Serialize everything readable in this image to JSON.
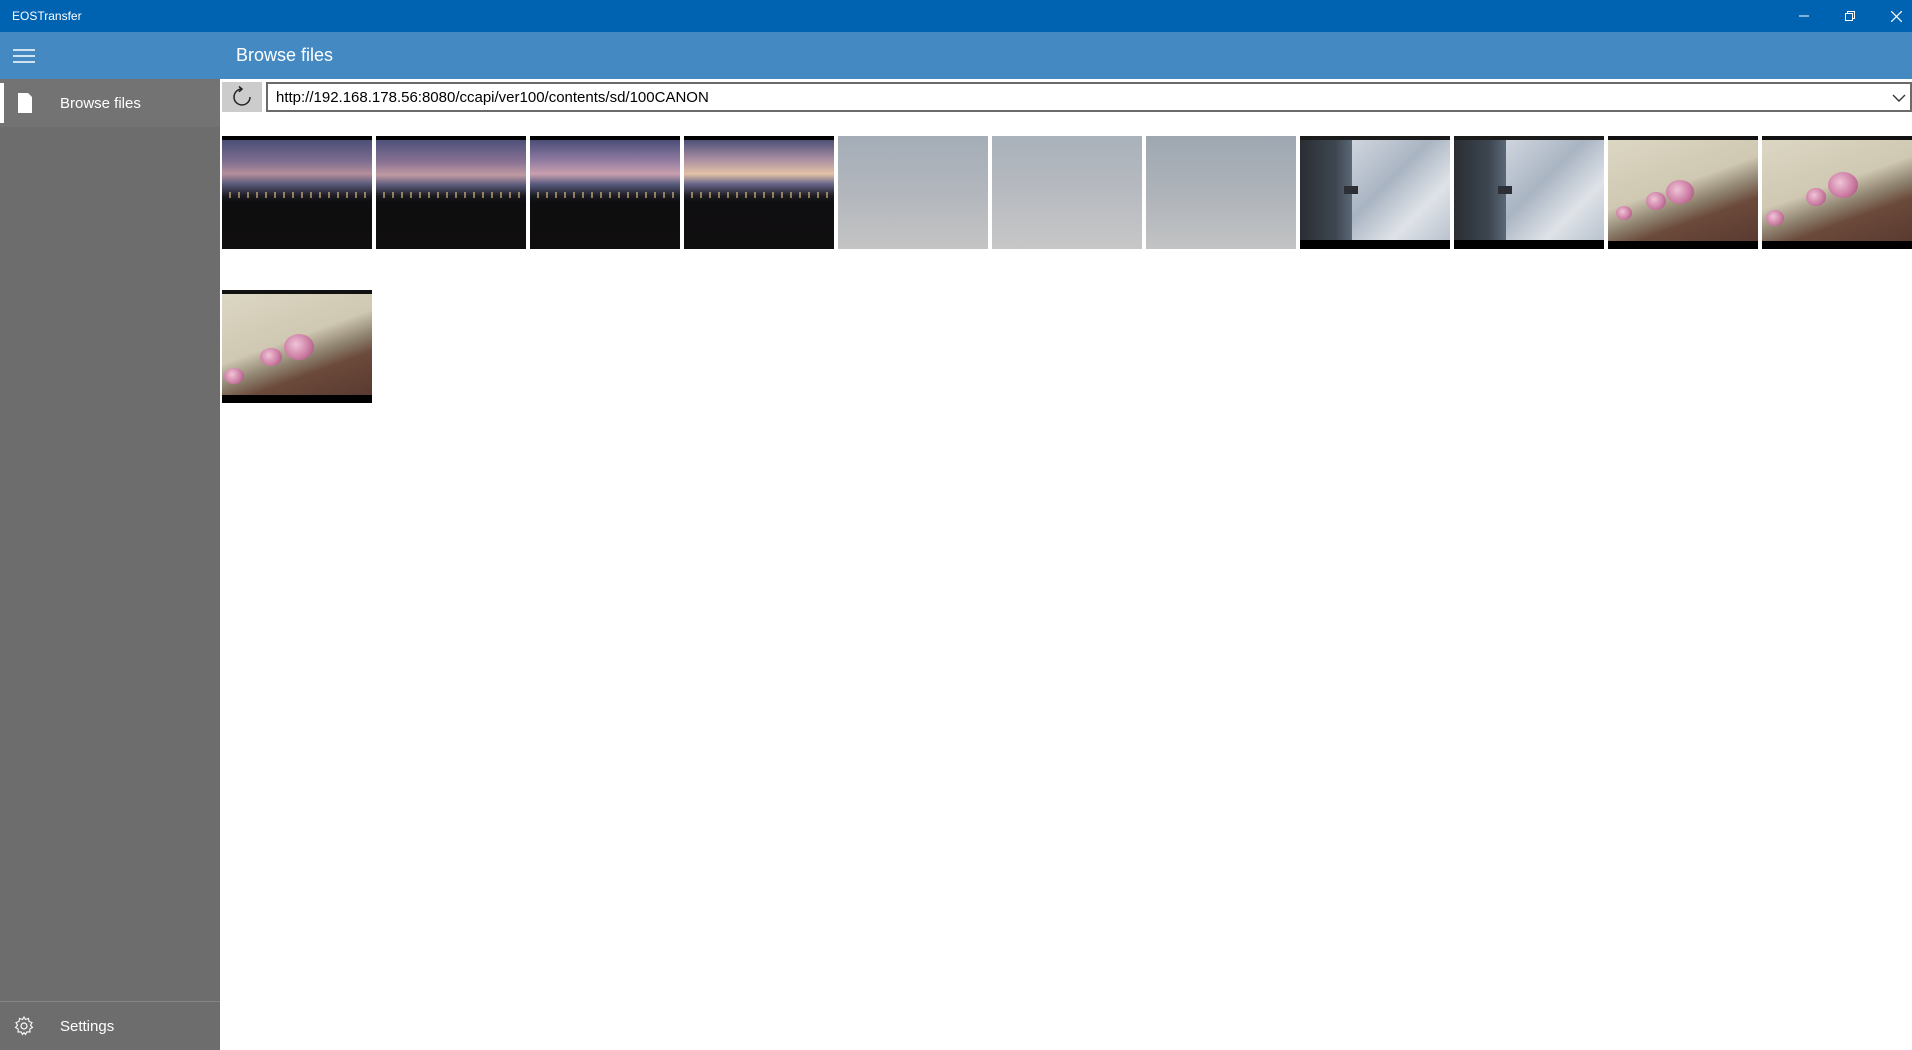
{
  "window": {
    "title": "EOSTransfer",
    "controls": {
      "minimize": "minimize",
      "restore": "restore",
      "close": "close"
    }
  },
  "header": {
    "page_title": "Browse files",
    "menu_icon": "hamburger-icon"
  },
  "sidebar": {
    "items": [
      {
        "label": "Browse files",
        "icon": "document-icon",
        "selected": true
      },
      {
        "label": "Settings",
        "icon": "gear-icon",
        "selected": false
      }
    ]
  },
  "address_bar": {
    "url": "http://192.168.178.56:8080/ccapi/ver100/contents/sd/100CANON",
    "refresh_icon": "refresh-icon",
    "dropdown_icon": "chevron-down-icon"
  },
  "thumbnails": [
    {
      "kind": "night-landscape"
    },
    {
      "kind": "night-landscape"
    },
    {
      "kind": "night-landscape"
    },
    {
      "kind": "night-landscape"
    },
    {
      "kind": "gray-sky"
    },
    {
      "kind": "gray-sky"
    },
    {
      "kind": "gray-sky"
    },
    {
      "kind": "river-rotated"
    },
    {
      "kind": "river-rotated"
    },
    {
      "kind": "orchid"
    },
    {
      "kind": "orchid"
    },
    {
      "kind": "orchid"
    }
  ],
  "colors": {
    "title_bar": "#0063b1",
    "header_bar": "#4489c2",
    "sidebar": "#6d6d6d"
  }
}
